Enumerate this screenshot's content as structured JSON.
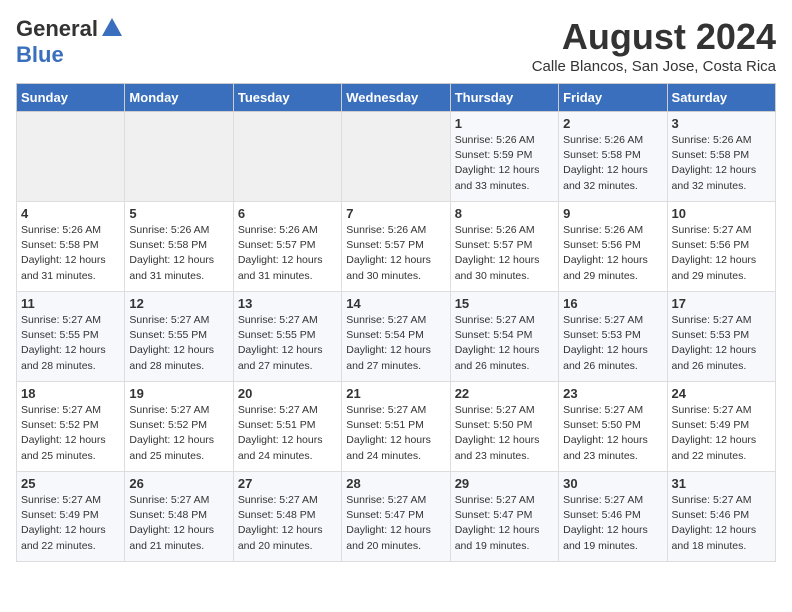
{
  "header": {
    "logo_general": "General",
    "logo_blue": "Blue",
    "month_year": "August 2024",
    "location": "Calle Blancos, San Jose, Costa Rica"
  },
  "weekdays": [
    "Sunday",
    "Monday",
    "Tuesday",
    "Wednesday",
    "Thursday",
    "Friday",
    "Saturday"
  ],
  "weeks": [
    [
      {
        "day": "",
        "info": ""
      },
      {
        "day": "",
        "info": ""
      },
      {
        "day": "",
        "info": ""
      },
      {
        "day": "",
        "info": ""
      },
      {
        "day": "1",
        "info": "Sunrise: 5:26 AM\nSunset: 5:59 PM\nDaylight: 12 hours\nand 33 minutes."
      },
      {
        "day": "2",
        "info": "Sunrise: 5:26 AM\nSunset: 5:58 PM\nDaylight: 12 hours\nand 32 minutes."
      },
      {
        "day": "3",
        "info": "Sunrise: 5:26 AM\nSunset: 5:58 PM\nDaylight: 12 hours\nand 32 minutes."
      }
    ],
    [
      {
        "day": "4",
        "info": "Sunrise: 5:26 AM\nSunset: 5:58 PM\nDaylight: 12 hours\nand 31 minutes."
      },
      {
        "day": "5",
        "info": "Sunrise: 5:26 AM\nSunset: 5:58 PM\nDaylight: 12 hours\nand 31 minutes."
      },
      {
        "day": "6",
        "info": "Sunrise: 5:26 AM\nSunset: 5:57 PM\nDaylight: 12 hours\nand 31 minutes."
      },
      {
        "day": "7",
        "info": "Sunrise: 5:26 AM\nSunset: 5:57 PM\nDaylight: 12 hours\nand 30 minutes."
      },
      {
        "day": "8",
        "info": "Sunrise: 5:26 AM\nSunset: 5:57 PM\nDaylight: 12 hours\nand 30 minutes."
      },
      {
        "day": "9",
        "info": "Sunrise: 5:26 AM\nSunset: 5:56 PM\nDaylight: 12 hours\nand 29 minutes."
      },
      {
        "day": "10",
        "info": "Sunrise: 5:27 AM\nSunset: 5:56 PM\nDaylight: 12 hours\nand 29 minutes."
      }
    ],
    [
      {
        "day": "11",
        "info": "Sunrise: 5:27 AM\nSunset: 5:55 PM\nDaylight: 12 hours\nand 28 minutes."
      },
      {
        "day": "12",
        "info": "Sunrise: 5:27 AM\nSunset: 5:55 PM\nDaylight: 12 hours\nand 28 minutes."
      },
      {
        "day": "13",
        "info": "Sunrise: 5:27 AM\nSunset: 5:55 PM\nDaylight: 12 hours\nand 27 minutes."
      },
      {
        "day": "14",
        "info": "Sunrise: 5:27 AM\nSunset: 5:54 PM\nDaylight: 12 hours\nand 27 minutes."
      },
      {
        "day": "15",
        "info": "Sunrise: 5:27 AM\nSunset: 5:54 PM\nDaylight: 12 hours\nand 26 minutes."
      },
      {
        "day": "16",
        "info": "Sunrise: 5:27 AM\nSunset: 5:53 PM\nDaylight: 12 hours\nand 26 minutes."
      },
      {
        "day": "17",
        "info": "Sunrise: 5:27 AM\nSunset: 5:53 PM\nDaylight: 12 hours\nand 26 minutes."
      }
    ],
    [
      {
        "day": "18",
        "info": "Sunrise: 5:27 AM\nSunset: 5:52 PM\nDaylight: 12 hours\nand 25 minutes."
      },
      {
        "day": "19",
        "info": "Sunrise: 5:27 AM\nSunset: 5:52 PM\nDaylight: 12 hours\nand 25 minutes."
      },
      {
        "day": "20",
        "info": "Sunrise: 5:27 AM\nSunset: 5:51 PM\nDaylight: 12 hours\nand 24 minutes."
      },
      {
        "day": "21",
        "info": "Sunrise: 5:27 AM\nSunset: 5:51 PM\nDaylight: 12 hours\nand 24 minutes."
      },
      {
        "day": "22",
        "info": "Sunrise: 5:27 AM\nSunset: 5:50 PM\nDaylight: 12 hours\nand 23 minutes."
      },
      {
        "day": "23",
        "info": "Sunrise: 5:27 AM\nSunset: 5:50 PM\nDaylight: 12 hours\nand 23 minutes."
      },
      {
        "day": "24",
        "info": "Sunrise: 5:27 AM\nSunset: 5:49 PM\nDaylight: 12 hours\nand 22 minutes."
      }
    ],
    [
      {
        "day": "25",
        "info": "Sunrise: 5:27 AM\nSunset: 5:49 PM\nDaylight: 12 hours\nand 22 minutes."
      },
      {
        "day": "26",
        "info": "Sunrise: 5:27 AM\nSunset: 5:48 PM\nDaylight: 12 hours\nand 21 minutes."
      },
      {
        "day": "27",
        "info": "Sunrise: 5:27 AM\nSunset: 5:48 PM\nDaylight: 12 hours\nand 20 minutes."
      },
      {
        "day": "28",
        "info": "Sunrise: 5:27 AM\nSunset: 5:47 PM\nDaylight: 12 hours\nand 20 minutes."
      },
      {
        "day": "29",
        "info": "Sunrise: 5:27 AM\nSunset: 5:47 PM\nDaylight: 12 hours\nand 19 minutes."
      },
      {
        "day": "30",
        "info": "Sunrise: 5:27 AM\nSunset: 5:46 PM\nDaylight: 12 hours\nand 19 minutes."
      },
      {
        "day": "31",
        "info": "Sunrise: 5:27 AM\nSunset: 5:46 PM\nDaylight: 12 hours\nand 18 minutes."
      }
    ]
  ]
}
